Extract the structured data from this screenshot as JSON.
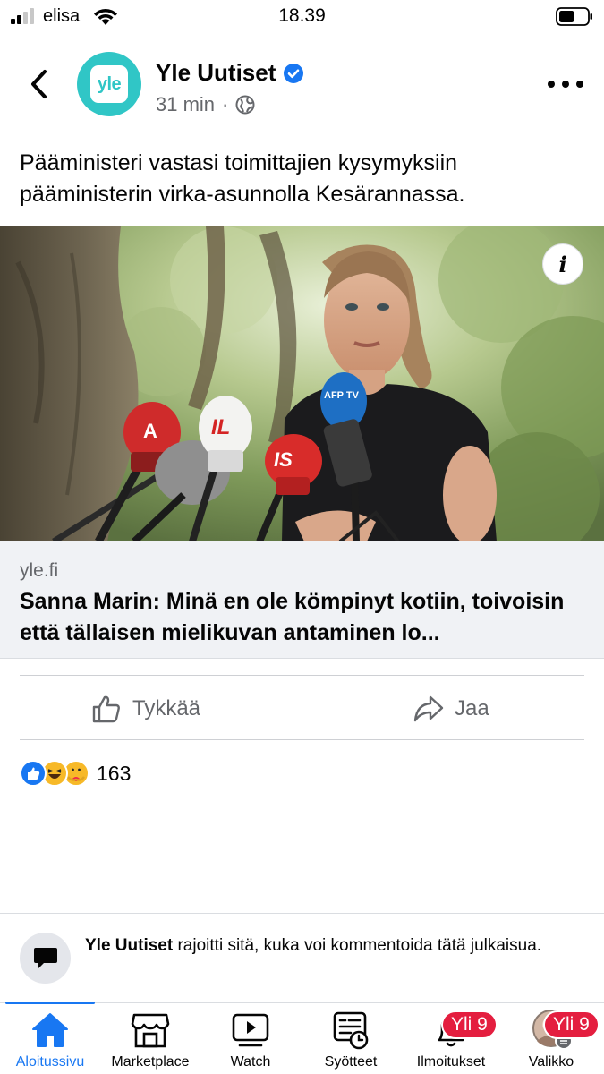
{
  "status_bar": {
    "carrier": "elisa",
    "time": "18.39",
    "signal_bars": 2,
    "signal_bars_total": 4,
    "battery_level": 0.55
  },
  "post": {
    "page_name": "Yle Uutiset",
    "avatar_text": "yle",
    "avatar_color": "#30c6c6",
    "verified": true,
    "time_ago": "31 min",
    "separator": "·",
    "audience_icon": "globe-icon",
    "text": "Pääministeri vastasi toimittajien kysymyksiin pääministerin virka-asunnolla Kesärannassa.",
    "info_button_label": "i"
  },
  "link_preview": {
    "domain": "yle.fi",
    "title": "Sanna Marin: Minä en ole kömpinyt kotiin, toivoisin että tällaisen mielikuvan antaminen lo..."
  },
  "photo": {
    "mic_labels": [
      "A",
      "IL",
      "IS",
      "AFP TV"
    ]
  },
  "actions": {
    "like_label": "Tykkää",
    "share_label": "Jaa"
  },
  "reactions": {
    "types": [
      "like",
      "haha",
      "care"
    ],
    "count": "163"
  },
  "comment_restriction": {
    "page_name": "Yle Uutiset",
    "message": " rajoitti sitä, kuka voi kommentoida tätä julkaisua."
  },
  "tab_bar": {
    "accent_color": "#1877f2",
    "badge_color": "#e41e3f",
    "tabs": [
      {
        "label": "Aloitussivu",
        "icon": "home-icon",
        "active": true
      },
      {
        "label": "Marketplace",
        "icon": "marketplace-icon"
      },
      {
        "label": "Watch",
        "icon": "watch-icon"
      },
      {
        "label": "Syötteet",
        "icon": "feeds-icon"
      },
      {
        "label": "Ilmoitukset",
        "icon": "bell-icon",
        "badge": "Yli 9"
      },
      {
        "label": "Valikko",
        "icon": "profile-avatar",
        "badge": "Yli 9"
      }
    ]
  }
}
